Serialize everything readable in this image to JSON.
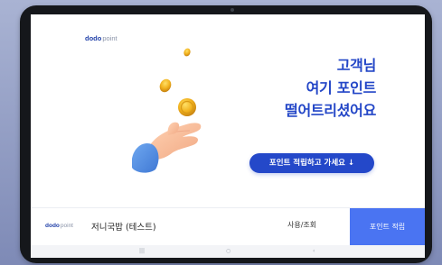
{
  "brand": {
    "name": "dodo",
    "suffix": "point",
    "primary_color": "#2346c7",
    "button_color": "#4a74f2"
  },
  "hero": {
    "lines": [
      "고객님",
      "여기 포인트",
      "떨어트리셨어요"
    ],
    "image": "hand-dropping-coins"
  },
  "cta": {
    "label": "포인트 적립하고 가세요",
    "arrow": "↓"
  },
  "bottom_bar": {
    "store_name": "저니국밥 (테스트)",
    "use_label": "사용/조회",
    "earn_label": "포인트 적립"
  },
  "nav": {
    "recent_icon": "|||",
    "home_icon": "○",
    "back_icon": "‹"
  }
}
